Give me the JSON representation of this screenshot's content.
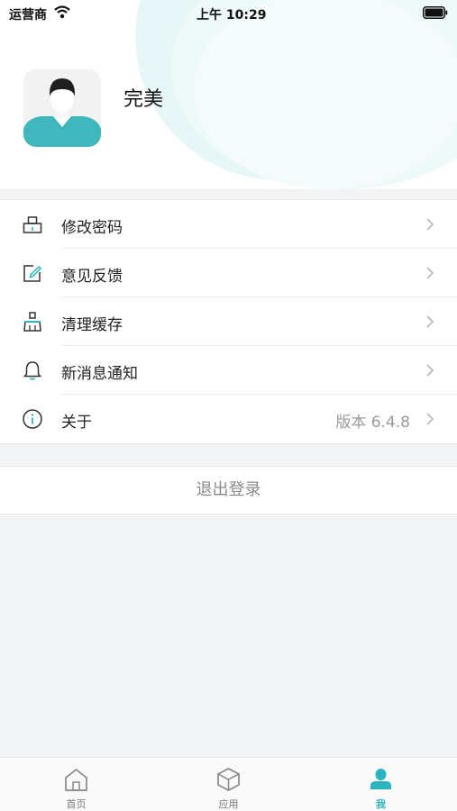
{
  "status_bar": {
    "carrier": "运营商",
    "time": "上午 10:29"
  },
  "profile": {
    "name": "完美"
  },
  "menu": [
    {
      "label": "修改密码",
      "icon": "lock-icon"
    },
    {
      "label": "意见反馈",
      "icon": "edit-icon"
    },
    {
      "label": "清理缓存",
      "icon": "broom-icon"
    },
    {
      "label": "新消息通知",
      "icon": "bell-icon"
    },
    {
      "label": "关于",
      "value": "版本 6.4.8",
      "icon": "info-icon"
    }
  ],
  "logout": {
    "label": "退出登录"
  },
  "tabbar": [
    {
      "label": "首页",
      "icon": "home-icon",
      "active": false
    },
    {
      "label": "应用",
      "icon": "box-icon",
      "active": false
    },
    {
      "label": "我",
      "icon": "person-icon",
      "active": true
    }
  ],
  "colors": {
    "accent": "#2bb3c0",
    "background": "#f3f4f6"
  }
}
